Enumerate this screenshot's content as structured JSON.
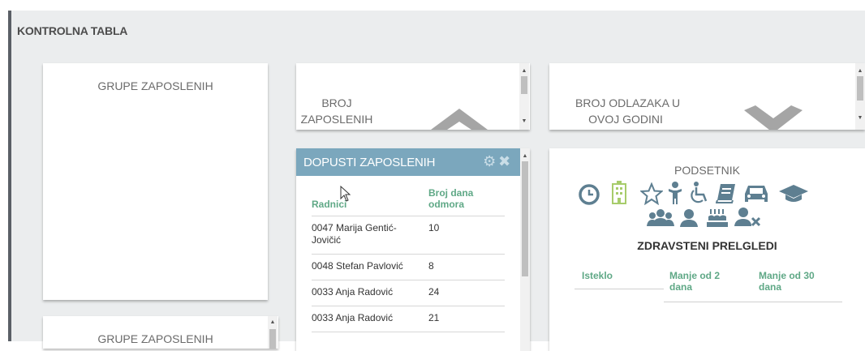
{
  "dashboard": {
    "title": "KONTROLNA TABLA"
  },
  "cards": {
    "grupe_zaposlenih": {
      "title": "GRUPE ZAPOSLENIH"
    },
    "grupe_zaposlenih_2": {
      "title": "GRUPE ZAPOSLENIH"
    },
    "broj_zaposlenih": {
      "title_line1": "BROJ",
      "title_line2": "ZAPOSLENIH"
    },
    "broj_odlazaka": {
      "title_line1": "BROJ ODLAZAKA U",
      "title_line2": "OVOJ GODINI"
    }
  },
  "dopusti": {
    "title": "DOPUSTI ZAPOSLENIH",
    "icons": [
      "gear-icon",
      "close-icon"
    ],
    "columns": [
      "Radnici",
      "Broj dana odmora"
    ],
    "rows": [
      {
        "name": "0047 Marija Gentić-Jovičić",
        "days": "10"
      },
      {
        "name": "0048 Stefan Pavlović",
        "days": "8"
      },
      {
        "name": "0033 Anja Radović",
        "days": "24"
      },
      {
        "name": "0033 Anja Radović",
        "days": "21"
      }
    ]
  },
  "podsetnik": {
    "title": "PODSETNIK",
    "icons": [
      "clock-icon",
      "hospital-icon",
      "star-icon",
      "person-icon",
      "wheelchair-icon",
      "book-icon",
      "car-icon",
      "graduation-cap-icon",
      "group-icon",
      "user-icon",
      "birthday-cake-icon",
      "user-remove-icon"
    ],
    "accent_color": "#5e7f91",
    "highlight_color": "#a7cc6b",
    "section_title": "ZDRAVSTENI PRELGLEDI",
    "columns": [
      "Isteklo",
      "Manje od 2 dana",
      "Manje od 30 dana"
    ]
  },
  "colors": {
    "header_blue": "#7ba7bd",
    "column_green": "#5fa886",
    "background": "#ebedee"
  }
}
